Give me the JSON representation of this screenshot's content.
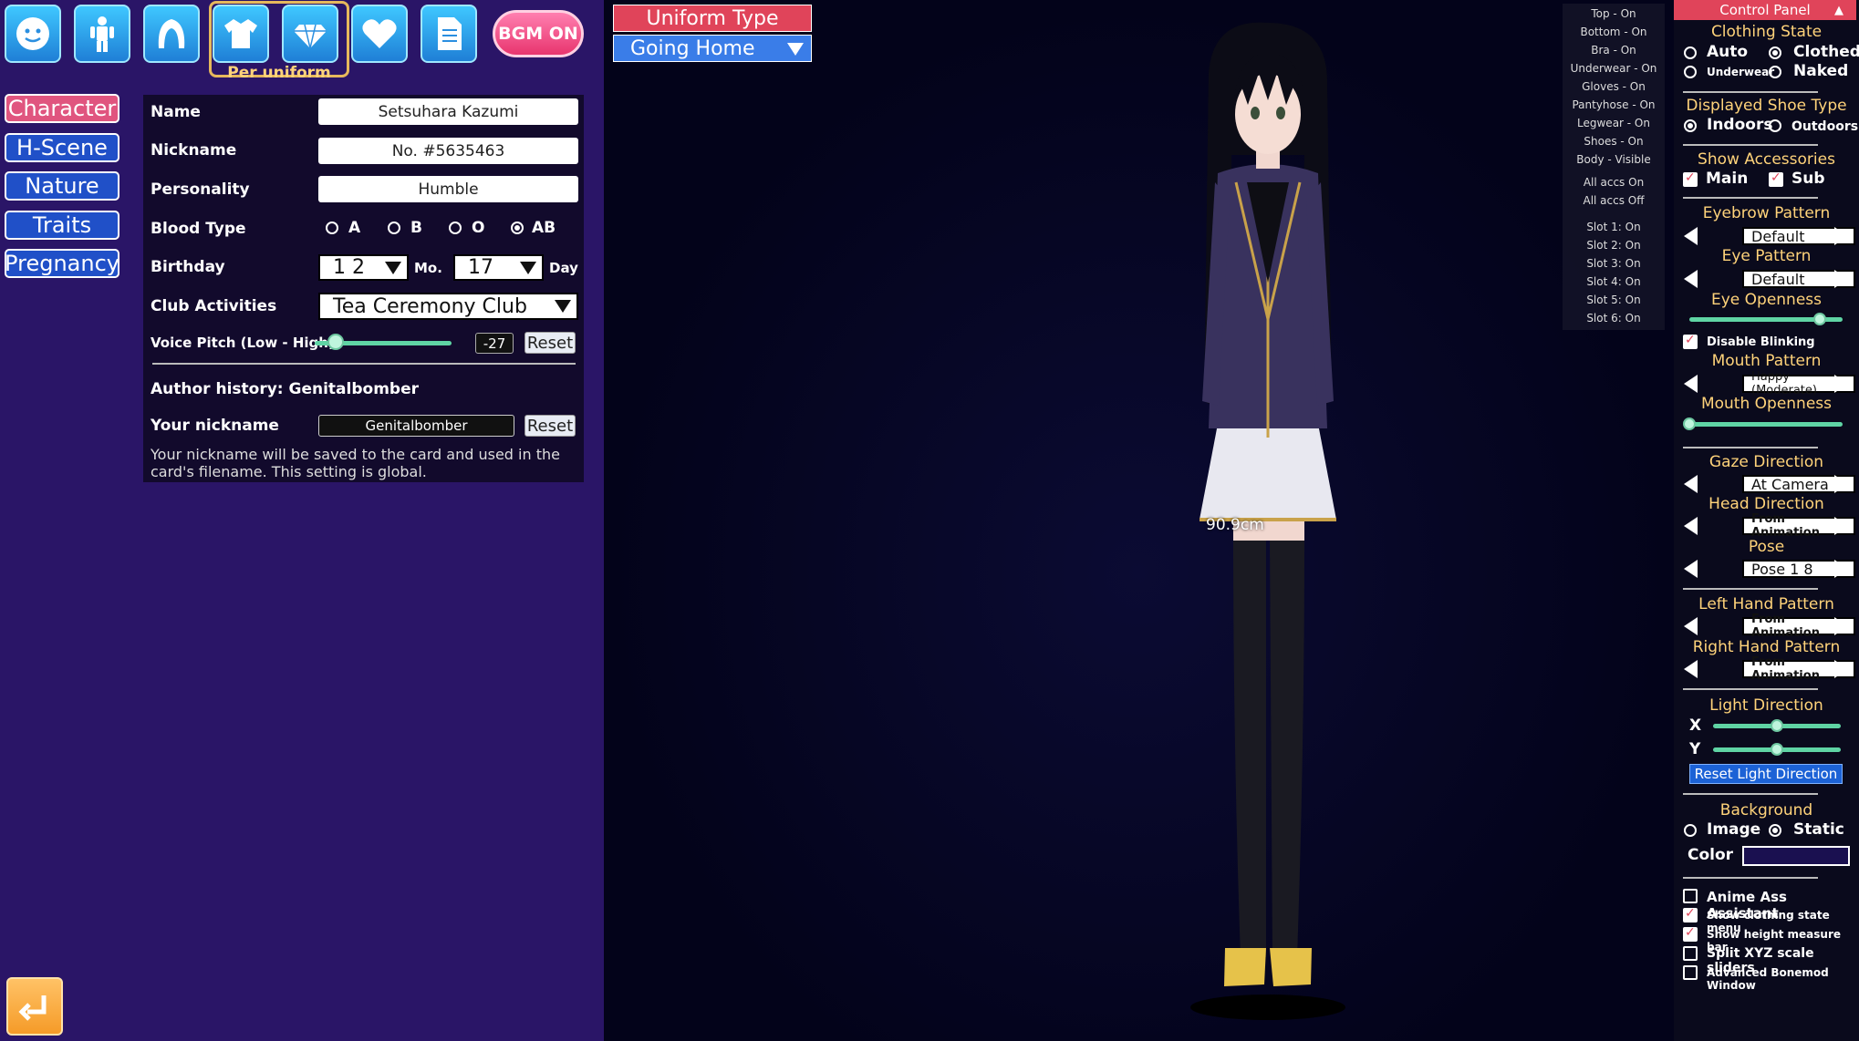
{
  "top_bar": {
    "icons": [
      "face-icon",
      "body-icon",
      "hair-icon",
      "clothes-icon",
      "accessory-icon",
      "heart-icon",
      "document-icon"
    ],
    "per_uniform_label": "Per uniform",
    "bgm_label": "BGM ON"
  },
  "nav": {
    "items": [
      "Character",
      "H-Scene",
      "Nature",
      "Traits",
      "Pregnancy"
    ],
    "active": "Character"
  },
  "character": {
    "name_label": "Name",
    "name_value": "Setsuhara Kazumi",
    "nickname_label": "Nickname",
    "nickname_value": "No. #5635463",
    "personality_label": "Personality",
    "personality_value": "Humble",
    "blood_label": "Blood Type",
    "blood_options": [
      "A",
      "B",
      "O",
      "AB"
    ],
    "blood_selected": "AB",
    "birthday_label": "Birthday",
    "birthday_month": "1 2",
    "month_unit": "Mo.",
    "birthday_day": "17",
    "day_unit": "Day",
    "club_label": "Club Activities",
    "club_value": "Tea Ceremony Club",
    "voice_label": "Voice Pitch (Low - High)",
    "voice_value": "-27",
    "voice_level": 0.15,
    "reset_label": "Reset",
    "author_history": "Author history: Genitalbomber",
    "your_nick_label": "Your nickname",
    "your_nick_value": "Genitalbomber",
    "nick_note": "Your nickname will be saved to the card and used in the card's filename. This setting is global."
  },
  "uniform": {
    "title": "Uniform Type",
    "value": "Going Home"
  },
  "clothing_state_list": {
    "items": [
      "Top - On",
      "Bottom - On",
      "Bra - On",
      "Underwear - On",
      "Gloves - On",
      "Pantyhose - On",
      "Legwear - On",
      "Shoes - On",
      "Body - Visible"
    ],
    "accs": [
      "All accs On",
      "All accs Off"
    ],
    "slots": [
      "Slot 1: On",
      "Slot 2: On",
      "Slot 3: On",
      "Slot 4: On",
      "Slot 5: On",
      "Slot 6: On"
    ]
  },
  "viewport": {
    "height_measure": "90.9cm"
  },
  "control_panel": {
    "header": "Control Panel",
    "clothing_state_title": "Clothing State",
    "clothing_options": [
      "Auto",
      "Clothed",
      "Underwear",
      "Naked"
    ],
    "clothing_selected": "Clothed",
    "shoe_title": "Displayed Shoe Type",
    "shoe_options": [
      "Indoors",
      "Outdoors"
    ],
    "shoe_selected": "Indoors",
    "accessories_title": "Show Accessories",
    "acc_main": "Main",
    "acc_sub": "Sub",
    "eyebrow_title": "Eyebrow Pattern",
    "eyebrow_value": "Default",
    "eye_title": "Eye Pattern",
    "eye_value": "Default",
    "eye_openness_title": "Eye Openness",
    "eye_openness_level": 0.85,
    "disable_blinking": "Disable Blinking",
    "mouth_title": "Mouth Pattern",
    "mouth_value": "Happy (Moderate)",
    "mouth_openness_title": "Mouth Openness",
    "mouth_openness_level": 0.0,
    "gaze_title": "Gaze Direction",
    "gaze_value": "At Camera",
    "head_title": "Head Direction",
    "head_value": "From Animation",
    "pose_title": "Pose",
    "pose_value": "Pose 1 8",
    "left_hand_title": "Left Hand Pattern",
    "left_hand_value": "From Animation",
    "right_hand_title": "Right Hand Pattern",
    "right_hand_value": "From Animation",
    "light_title": "Light Direction",
    "light_x_label": "X",
    "light_y_label": "Y",
    "light_x_level": 0.5,
    "light_y_level": 0.5,
    "reset_light": "Reset Light Direction",
    "background_title": "Background",
    "bg_options": [
      "Image",
      "Static"
    ],
    "bg_selected": "Static",
    "color_label": "Color",
    "bg_color": "#1a1050",
    "checks": [
      {
        "label": "Anime Ass Assistant",
        "checked": false
      },
      {
        "label": "Show clothing state menu",
        "checked": true
      },
      {
        "label": "Show height measure bar",
        "checked": true
      },
      {
        "label": "Split XYZ scale sliders",
        "checked": false
      },
      {
        "label": "Advanced Bonemod Window",
        "checked": false
      }
    ]
  },
  "colors": {
    "accent_pink": "#e0445a",
    "accent_blue": "#3a7de8",
    "panel_purple": "#2a1567",
    "title_gold": "#ffd37a"
  }
}
